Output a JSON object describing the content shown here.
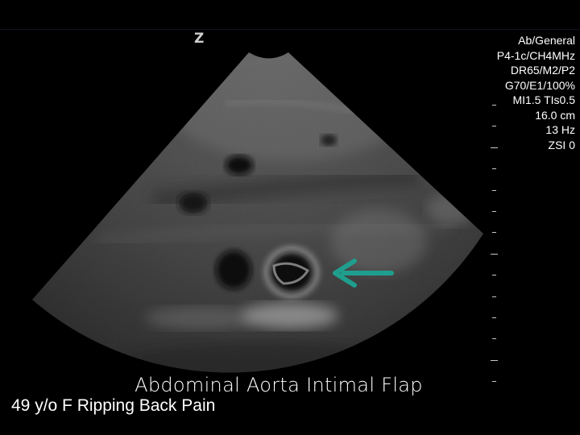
{
  "image": {
    "orientation_mark": "Z",
    "caption": "Abdominal Aorta Intimal Flap",
    "patient_info": "49 y/o F Ripping Back Pain",
    "arrow_color": "#1f9e8e"
  },
  "scan_params": [
    "Ab/General",
    "P4-1c/CH4MHz",
    "DR65/M2/P2",
    "G70/E1/100%",
    "MI1.5  TIs0.5",
    "16.0 cm",
    "13 Hz",
    "ZSI 0"
  ]
}
